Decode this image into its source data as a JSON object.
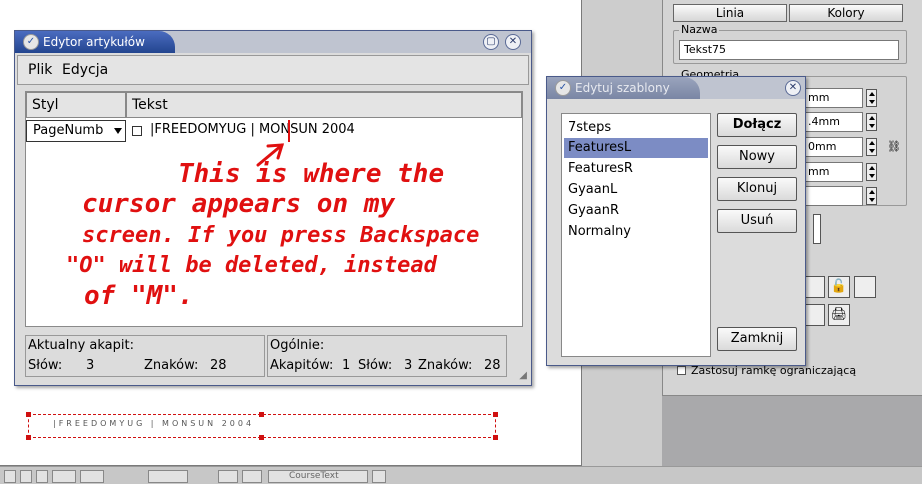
{
  "editor": {
    "title": "Edytor artykułów",
    "menu": [
      "Plik",
      "Edycja"
    ],
    "columns": {
      "style": "Styl",
      "text": "Tekst"
    },
    "paragraph": {
      "style": "PageNumb",
      "text": "|FREEDOMYUG | MONSUN 2004"
    },
    "annotation": [
      "This is where the",
      "cursor appears on my",
      "screen. If you press Backspace",
      "\"O\" will be deleted, instead",
      "of \"M\"."
    ],
    "status": {
      "current_label": "Aktualny akapit:",
      "words_label": "Słów:",
      "words": "3",
      "chars_label": "Znaków:",
      "chars": "28",
      "total_label": "Ogólnie:",
      "paras_label": "Akapitów:",
      "paras": "1",
      "total_words_label": "Słów:",
      "total_words": "3",
      "total_chars_label": "Znaków:",
      "total_chars": "28"
    }
  },
  "templates": {
    "title": "Edytuj szablony",
    "items": [
      "7steps",
      "FeaturesL",
      "FeaturesR",
      "GyaanL",
      "GyaanR",
      "Normalny"
    ],
    "selected": "FeaturesL",
    "buttons": {
      "append": "Dołącz",
      "new": "Nowy",
      "clone": "Klonuj",
      "delete": "Usuń",
      "close": "Zamknij"
    }
  },
  "properties": {
    "tabs": [
      "Linia",
      "Kolory"
    ],
    "name_label": "Nazwa",
    "name_value": "Tekst75",
    "geometry_label": "Geometria",
    "geom_values": [
      "mm",
      ".4mm",
      "0mm",
      "mm"
    ],
    "bounding_frame": "Zastosuj ramkę ograniczającą"
  },
  "canvas": {
    "frame_text": "|FREEDOMYUG | MONSUN 2004"
  },
  "statusbar": {
    "style": "CourseText"
  },
  "colors": {
    "title_active": "#23458f",
    "selection": "#7c8cc4",
    "annotation": "#e01010"
  }
}
